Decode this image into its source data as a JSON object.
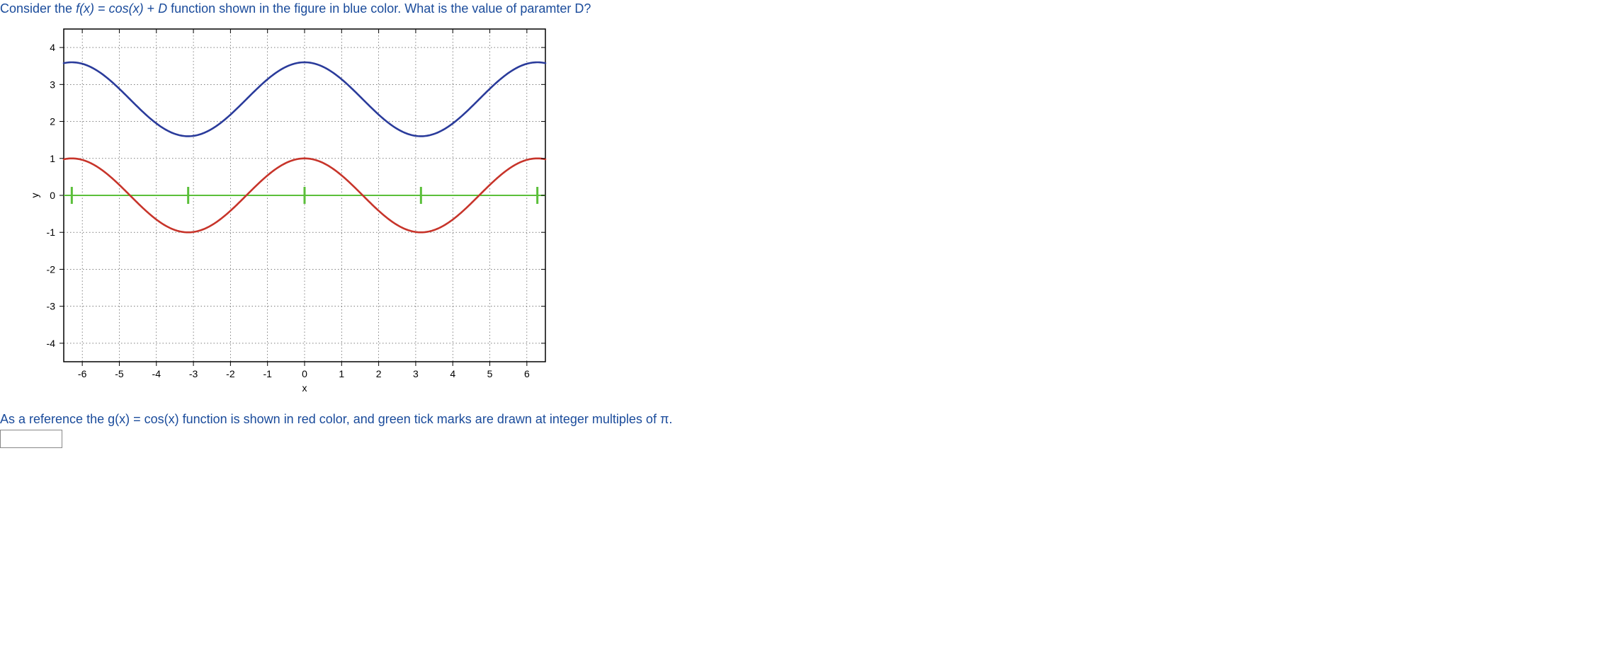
{
  "question": {
    "part1": "Consider the ",
    "fx": "f(x)",
    "eq": " = ",
    "cos": "cos(x)",
    "plus": " + ",
    "D": "D",
    "part2": " function shown in the figure in blue color. What is the value of paramter D?"
  },
  "footer": {
    "part1": "As a reference the ",
    "gx": "g(x)",
    "eq2": " = ",
    "cos2": "cos(x)",
    "part2": " function is shown in red color, and green tick marks are drawn at integer multiples of π."
  },
  "chart_data": {
    "type": "line",
    "xlabel": "x",
    "ylabel": "y",
    "xlim": [
      -6.5,
      6.5
    ],
    "ylim": [
      -4.5,
      4.5
    ],
    "xticks": [
      -6,
      -5,
      -4,
      -3,
      -2,
      -1,
      0,
      1,
      2,
      3,
      4,
      5,
      6
    ],
    "yticks": [
      -4,
      -3,
      -2,
      -1,
      0,
      1,
      2,
      3,
      4
    ],
    "grid_x_minor": [
      -6,
      -5,
      -4,
      -3,
      -2,
      -1,
      0,
      1,
      2,
      3,
      4,
      5,
      6
    ],
    "grid_y_minor": [
      -4,
      -3,
      -2,
      -1,
      0,
      1,
      2,
      3,
      4
    ],
    "series": [
      {
        "name": "f(x) = cos(x) + D (blue)",
        "color": "#2a3b9b",
        "formula": "cos(x)+2.6",
        "D_estimate": 2.6,
        "sample_points": [
          {
            "x": -6.28,
            "y": 3.6
          },
          {
            "x": -3.14,
            "y": 1.6
          },
          {
            "x": 0,
            "y": 3.6
          },
          {
            "x": 3.14,
            "y": 1.6
          },
          {
            "x": 6.28,
            "y": 3.6
          }
        ]
      },
      {
        "name": "g(x) = cos(x) (red)",
        "color": "#c7342a",
        "formula": "cos(x)",
        "sample_points": [
          {
            "x": -6.28,
            "y": 1
          },
          {
            "x": -3.14,
            "y": -1
          },
          {
            "x": 0,
            "y": 1
          },
          {
            "x": 3.14,
            "y": -1
          },
          {
            "x": 6.28,
            "y": 1
          }
        ]
      }
    ],
    "green_ticks_x": [
      -6.2832,
      -3.1416,
      0,
      3.1416,
      6.2832
    ],
    "green_axis_y": 0
  }
}
